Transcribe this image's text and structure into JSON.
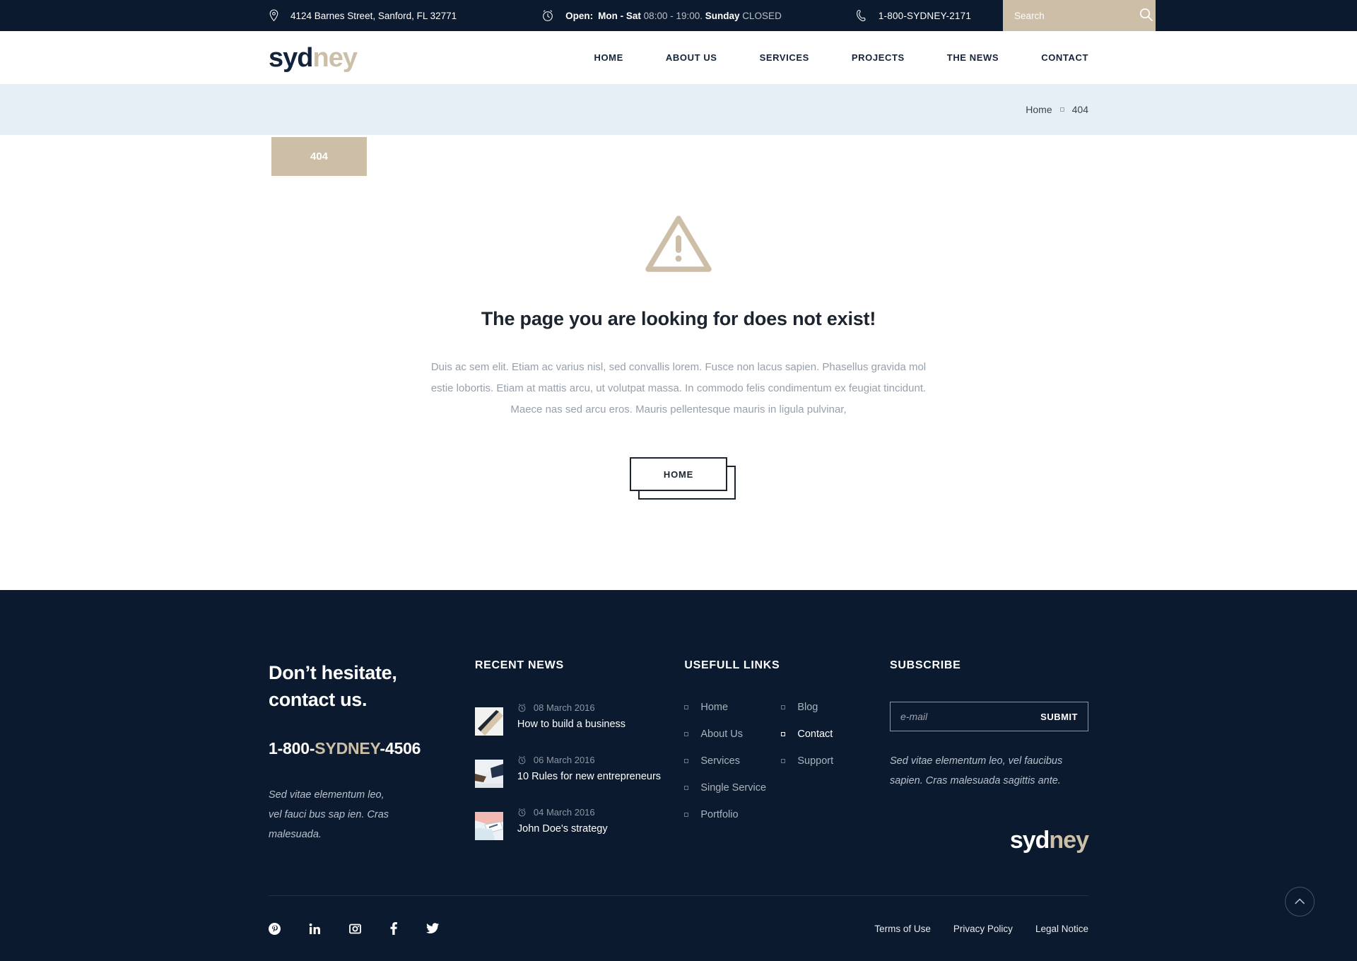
{
  "topbar": {
    "address": "4124 Barnes Street, Sanford, FL 32771",
    "hours_label": "Open:",
    "hours_days": "Mon - Sat",
    "hours_time": "08:00 - 19:00.",
    "hours_sunday": "Sunday",
    "hours_closed": "CLOSED",
    "phone": "1-800-SYDNEY-2171",
    "search_placeholder": "Search",
    "search_value": "",
    "icons": {
      "location": "map-pin-icon",
      "clock": "alarm-clock-icon",
      "phone": "phone-handset-icon",
      "search": "search-icon"
    }
  },
  "header": {
    "logo_dark": "syd",
    "logo_light": "ney",
    "nav": [
      {
        "label": "HOME"
      },
      {
        "label": "ABOUT US"
      },
      {
        "label": "SERVICES"
      },
      {
        "label": "PROJECTS"
      },
      {
        "label": "THE NEWS"
      },
      {
        "label": "CONTACT"
      }
    ]
  },
  "breadcrumb": {
    "home": "Home",
    "current": "404",
    "page_chip": "404"
  },
  "main": {
    "heading": "The page you are looking for does not exist!",
    "paragraph": "Duis ac sem elit. Etiam ac varius nisl, sed convallis lorem. Fusce non lacus sapien. Phasellus gravida mol estie lobortis. Etiam at mattis arcu, ut volutpat massa. In commodo felis condimentum ex feugiat tincidunt. Maece nas sed arcu eros. Mauris pellentesque mauris in ligula pulvinar,",
    "home_button": "HOME",
    "warning_icon": "warning-triangle-icon"
  },
  "footer": {
    "contact": {
      "heading_line1": "Don’t hesitate,",
      "heading_line2": "contact us.",
      "phone_prefix": "1-800-",
      "phone_highlight": "SYDNEY",
      "phone_suffix": "-4506",
      "note": "Sed vitae elementum leo, vel fauci bus sap ien. Cras malesuada."
    },
    "news": {
      "heading": "RECENT NEWS",
      "items": [
        {
          "date": "08 March 2016",
          "title": "How to build a business"
        },
        {
          "date": "06 March 2016",
          "title": "10 Rules for new entrepreneurs"
        },
        {
          "date": "04 March 2016",
          "title": "John Doe's strategy"
        }
      ]
    },
    "links": {
      "heading": "USEFULL LINKS",
      "column1": [
        {
          "label": "Home",
          "active": false
        },
        {
          "label": "About Us",
          "active": false
        },
        {
          "label": "Services",
          "active": false
        },
        {
          "label": "Single Service",
          "active": false
        },
        {
          "label": "Portfolio",
          "active": false
        }
      ],
      "column2": [
        {
          "label": "Blog",
          "active": false
        },
        {
          "label": "Contact",
          "active": true
        },
        {
          "label": "Support",
          "active": false
        }
      ]
    },
    "subscribe": {
      "heading": "SUBSCRIBE",
      "email_placeholder": "e-mail",
      "email_value": "",
      "submit_label": "SUBMIT",
      "note": "Sed vitae elementum leo, vel faucibus sapien. Cras malesuada sagittis ante.",
      "logo_white": "syd",
      "logo_tan": "ney"
    },
    "socials": [
      {
        "name": "pinterest-icon"
      },
      {
        "name": "linkedin-icon"
      },
      {
        "name": "instagram-icon"
      },
      {
        "name": "facebook-icon"
      },
      {
        "name": "twitter-icon"
      }
    ],
    "legal": [
      {
        "label": "Terms of Use"
      },
      {
        "label": "Privacy Policy"
      },
      {
        "label": "Legal Notice"
      }
    ],
    "scroll_top_icon": "chevron-up-icon"
  },
  "colors": {
    "navy": "#0b1a2e",
    "tan": "#cdbfa7",
    "band": "#e5eff5",
    "text_dark": "#1c2430",
    "muted": "#98a0ab"
  }
}
